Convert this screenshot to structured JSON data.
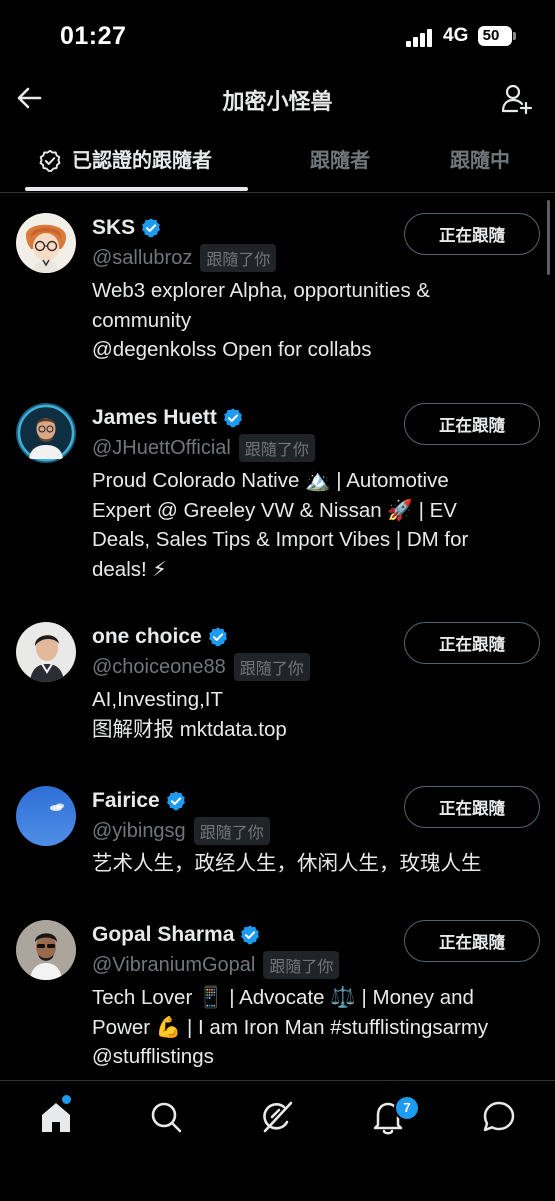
{
  "status_bar": {
    "time": "01:27",
    "network": "4G",
    "battery": "50"
  },
  "header": {
    "title": "加密小怪兽"
  },
  "tabs": [
    {
      "label": "已認證的跟隨者",
      "active": true
    },
    {
      "label": "跟隨者",
      "active": false
    },
    {
      "label": "跟隨中",
      "active": false
    }
  ],
  "users": [
    {
      "name": "SKS",
      "handle": "@sallubroz",
      "follows_you": "跟隨了你",
      "bio": [
        "Web3 explorer Alpha, opportunities &",
        "community",
        "@degenkolss Open for collabs"
      ],
      "button": "正在跟隨"
    },
    {
      "name": "James Huett",
      "handle": "@JHuettOfficial",
      "follows_you": "跟隨了你",
      "bio": [
        "Proud Colorado Native 🏔️ | Automotive",
        "Expert @ Greeley VW & Nissan 🚀 | EV",
        "Deals, Sales Tips & Import Vibes | DM for",
        "deals! ⚡"
      ],
      "button": "正在跟隨"
    },
    {
      "name": "one choice",
      "handle": "@choiceone88",
      "follows_you": "跟隨了你",
      "bio": [
        "AI,Investing,IT",
        "图解财报 mktdata.top"
      ],
      "button": "正在跟隨"
    },
    {
      "name": "Fairice",
      "handle": "@yibingsg",
      "follows_you": "跟隨了你",
      "bio": [
        "艺术人生，政经人生，休闲人生，玫瑰人生"
      ],
      "button": "正在跟隨"
    },
    {
      "name": "Gopal Sharma",
      "handle": "@VibraniumGopal",
      "follows_you": "跟隨了你",
      "bio": [
        "Tech Lover 📱 | Advocate ⚖️ | Money and",
        "Power 💪 | I am Iron Man #stufflistingsarmy",
        "@stufflistings"
      ],
      "button": "正在跟隨"
    }
  ],
  "bottom_nav": {
    "items": [
      "home-icon",
      "search-icon",
      "grok-icon",
      "bell-icon",
      "messages-icon"
    ],
    "notification_count": "7"
  },
  "colors": {
    "accent": "#1d9bf0",
    "background": "#000000",
    "secondary_text": "#71767b",
    "border": "#2f3336"
  }
}
